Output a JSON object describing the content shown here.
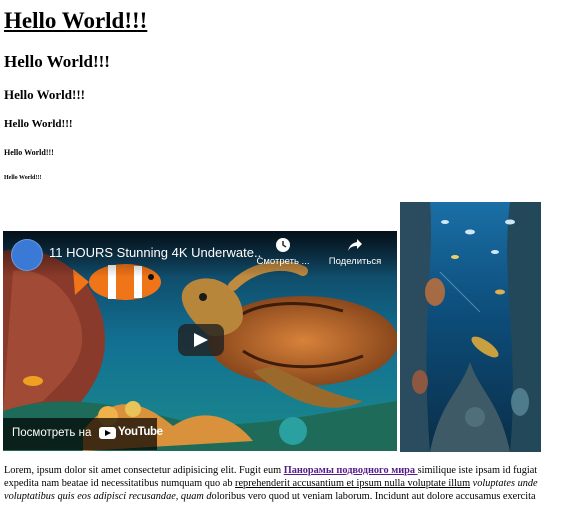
{
  "headings": {
    "h1": "Hello World!!!",
    "h2": "Hello World!!!",
    "h3": "Hello World!!!",
    "h4": "Hello World!!!",
    "h5": "Hello World!!!",
    "h6": "Hello World!!!"
  },
  "video": {
    "title": "11 HOURS Stunning 4K Underwate...",
    "watch_later_label": "Смотреть ...",
    "share_label": "Поделиться",
    "watch_on_label": "Посмотреть на",
    "logo_text": "YouTube",
    "icons": [
      "channel-avatar",
      "clock-icon",
      "share-icon",
      "play-icon",
      "youtube-logo-icon"
    ]
  },
  "paragraph": {
    "line1_a": "Lorem, ipsum dolor sit amet consectetur adipisicing elit. Fugit eum ",
    "line1_link": "Панорамы подводного мира ",
    "line1_b": "similique iste ipsam id fugiat",
    "line2_a": "expedita nam beatae id necessitatibus numquam quo ab ",
    "line2_u": "reprehenderit accusantium et ipsum nulla voluptate illum",
    "line2_i": " voluptates unde",
    "line3_i": "voluptatibus quis eos adipisci recusandae, quam d",
    "line3_b": "oloribus vero quod ut veniam laborum. Incidunt aut dolore accusamus exercita"
  },
  "colors": {
    "link": "#551a8b",
    "video_overlay": "#000000",
    "ocean": "#0a4f74"
  }
}
